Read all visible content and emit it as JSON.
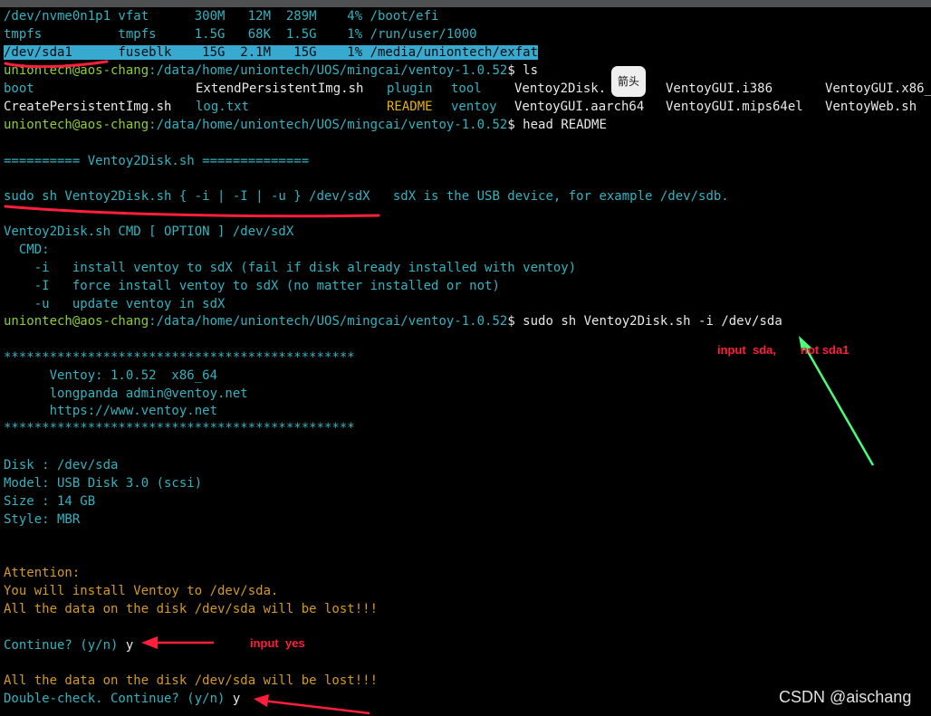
{
  "df": {
    "row1": "/dev/nvme0n1p1 vfat      300M   12M  289M    4% /boot/efi",
    "row2": "tmpfs          tmpfs     1.5G   68K  1.5G    1% /run/user/1000",
    "row3": "/dev/sda1      fuseblk    15G  2.1M   15G    1% /media/uniontech/exfat"
  },
  "prompt": {
    "user_host": "uniontech@aos-chang",
    "path": ":/data/home/uniontech/UOS/mingcai/ventoy-1.0.52",
    "symbol": "$"
  },
  "commands": {
    "ls": " ls",
    "head": " head README",
    "install": " sudo sh Ventoy2Disk.sh -i /dev/sda"
  },
  "ls_output": {
    "boot": "boot",
    "extend": "ExtendPersistentImg.sh",
    "plugin": "plugin",
    "tool": "tool",
    "ventoy2disk": "Ventoy2Disk.",
    "gui_i386": "VentoyGUI.i386",
    "gui_x86": "VentoyGUI.x86_",
    "create": "CreatePersistentImg.sh",
    "log": "log.txt",
    "readme": "README",
    "ventoy": "ventoy",
    "gui_aarch64": "VentoyGUI.aarch64",
    "gui_mips": "VentoyGUI.mips64el",
    "web": "VentoyWeb.sh"
  },
  "tooltip": "箭头",
  "readme": {
    "header": "========== Ventoy2Disk.sh ==============",
    "usage": "sudo sh Ventoy2Disk.sh { -i | -I | -u } /dev/sdX",
    "usage_note": "   sdX is the USB device, for example /dev/sdb.",
    "syntax": "Ventoy2Disk.sh CMD [ OPTION ] /dev/sdX",
    "cmd": "  CMD:",
    "opt_i": "    -i   install ventoy to sdX (fail if disk already installed with ventoy)",
    "opt_I": "    -I   force install ventoy to sdX (no matter installed or not)",
    "opt_u": "    -u   update ventoy in sdX"
  },
  "banner": {
    "stars": "**********************************************",
    "version": "      Ventoy: 1.0.52  x86_64",
    "author": "      longpanda admin@ventoy.net",
    "site": "      https://www.ventoy.net"
  },
  "disk": {
    "disk": "Disk : /dev/sda",
    "model": "Model: USB Disk 3.0 (scsi)",
    "size": "Size : 14 GB",
    "style": "Style: MBR"
  },
  "attention": {
    "title": "Attention:",
    "install": "You will install Ventoy to /dev/sda.",
    "lost": "All the data on the disk /dev/sda will be lost!!!"
  },
  "confirm": {
    "continue": "Continue? (y/n) ",
    "answer1": "y",
    "lost_again": "All the data on the disk /dev/sda will be lost!!!",
    "double_check": "Double-check. Continue? (y/n) ",
    "answer2": "y"
  },
  "annotations": {
    "sda_note_a": "input  sda,",
    "sda_note_b": "not sda1",
    "yes_note": "input  yes"
  },
  "watermark": "CSDN @aischang",
  "colors": {
    "background": "#000000",
    "text": "#33b3c0",
    "prompt_user": "#8ccf34",
    "readme": "#e5b400",
    "attention": "#d59a1f",
    "highlight": "#38aacf",
    "annotation_red": "#ff1e3c",
    "annotation_green": "#49ff7a"
  }
}
